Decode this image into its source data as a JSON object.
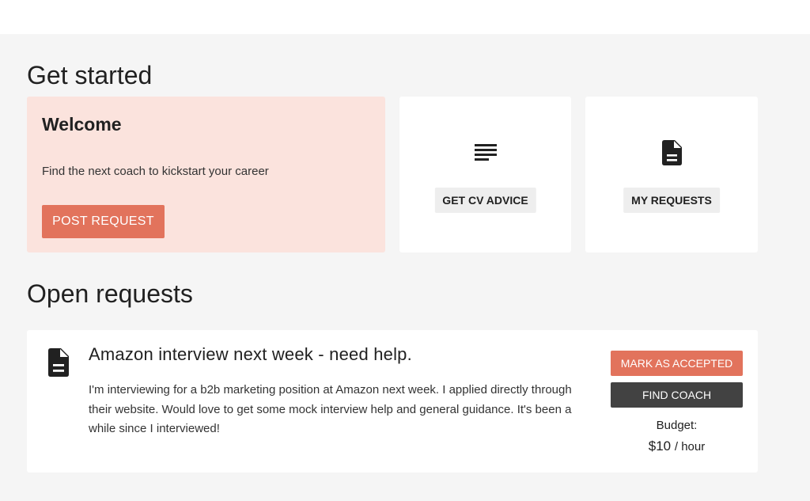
{
  "get_started": {
    "title": "Get started",
    "welcome": {
      "title": "Welcome",
      "subtitle": "Find the next coach to kickstart your career",
      "button_label": "POST REQUEST"
    },
    "cv_advice": {
      "icon": "text-lines-icon",
      "button_label": "GET CV ADVICE"
    },
    "my_requests": {
      "icon": "document-icon",
      "button_label": "MY REQUESTS"
    }
  },
  "open_requests": {
    "title": "Open requests",
    "items": [
      {
        "icon": "document-icon",
        "title": "Amazon interview next week - need help.",
        "description": "I'm interviewing for a b2b marketing position at Amazon next week. I applied directly through their website. Would love to get some mock interview help and general guidance. It's been a while since I interviewed!",
        "accept_label": "MARK AS ACCEPTED",
        "find_coach_label": "FIND COACH",
        "budget_label": "Budget:",
        "budget_amount": "$10",
        "budget_unit": "/ hour"
      }
    ]
  },
  "colors": {
    "accent": "#e2735c",
    "welcome_bg": "#fbe3dd",
    "dark_button": "#424242",
    "page_bg": "#f5f5f5"
  }
}
